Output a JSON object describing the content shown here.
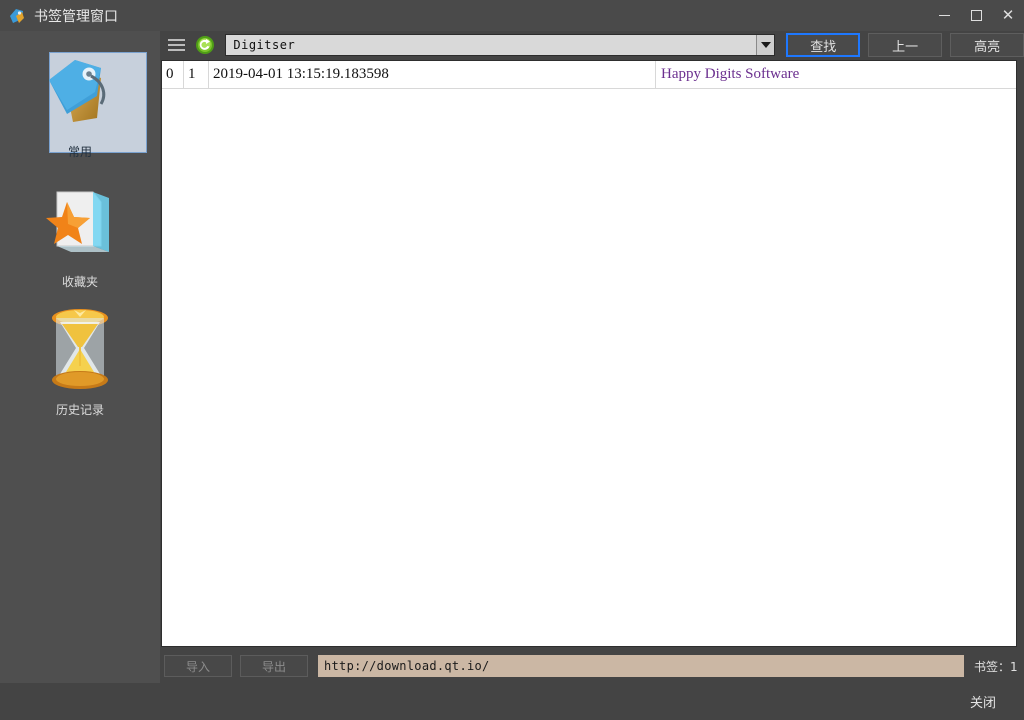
{
  "window": {
    "title": "书签管理窗口",
    "icon": "bookmark-tag-icon",
    "controls": {
      "minimize": "–",
      "maximize": "□",
      "close": "✕"
    }
  },
  "sidebar": {
    "items": [
      {
        "label": "常用",
        "icon": "tags-icon",
        "selected": true
      },
      {
        "label": "收藏夹",
        "icon": "folder-star-icon",
        "selected": false
      },
      {
        "label": "历史记录",
        "icon": "hourglass-icon",
        "selected": false
      }
    ]
  },
  "toolbar": {
    "menu_icon": "hamburger-menu-icon",
    "refresh_icon": "refresh-green-icon",
    "search": {
      "value": "Digitser",
      "placeholder": "Digitser"
    },
    "buttons": [
      {
        "label": "查找",
        "focused": true
      },
      {
        "label": "上一",
        "focused": false
      },
      {
        "label": "高亮",
        "focused": false
      }
    ]
  },
  "table": {
    "rows": [
      {
        "index": "0",
        "num": "1",
        "timestamp": "2019-04-01 13:15:19.183598",
        "title": "Happy Digits Software"
      }
    ]
  },
  "bottom": {
    "import_label": "导入",
    "export_label": "导出",
    "url": "http://download.qt.io/",
    "count_label": "书签：1"
  },
  "footer": {
    "close_label": "关闭"
  },
  "colors": {
    "window_bg": "#444444",
    "sidebar_bg": "#4f4f4f",
    "titlebar_bg": "#4a4a4a",
    "accent_focus": "#1e78ff",
    "link_text": "#6b2f8f",
    "url_field_bg": "#cbb7a4",
    "combo_bg": "#d9d9d9",
    "selection_bg": "#c7d0dc"
  }
}
